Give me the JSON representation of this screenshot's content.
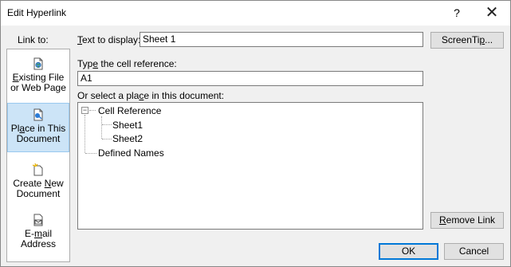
{
  "window": {
    "title": "Edit Hyperlink",
    "help_label": "?",
    "close_label": "✕"
  },
  "linkbar": {
    "label": "Link to:",
    "items": [
      {
        "line1": "Existing File",
        "line2": "or Web Page",
        "icon": "web-page-icon",
        "selected": false
      },
      {
        "line1": "Place in This",
        "line2": "Document",
        "icon": "document-place-icon",
        "selected": true
      },
      {
        "line1": "Create New",
        "line2": "Document",
        "icon": "new-document-icon",
        "selected": false
      },
      {
        "line1": "E-mail",
        "line2": "Address",
        "icon": "email-icon",
        "selected": false
      }
    ]
  },
  "display": {
    "label": "Text to display:",
    "value": "Sheet 1",
    "screentip_label": "ScreenTip..."
  },
  "cell_ref": {
    "label": "Type the cell reference:",
    "value": "A1"
  },
  "place": {
    "label": "Or select a place in this document:",
    "tree": {
      "root": "Cell Reference",
      "expander": "−",
      "children": [
        "Sheet1",
        "Sheet2"
      ],
      "defined_names": "Defined Names"
    }
  },
  "buttons": {
    "remove_link": "Remove Link",
    "ok": "OK",
    "cancel": "Cancel"
  },
  "colors": {
    "selection": "#cce4f7",
    "default_button_border": "#0078d7"
  }
}
